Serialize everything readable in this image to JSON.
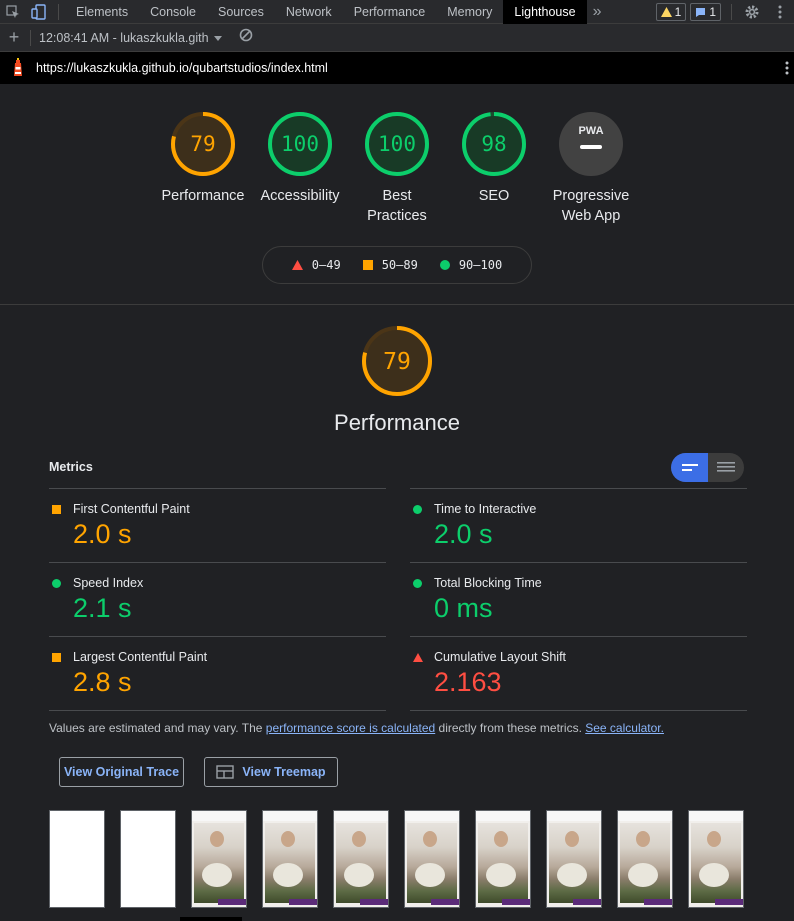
{
  "devtools": {
    "tabs": [
      "Elements",
      "Console",
      "Sources",
      "Network",
      "Performance",
      "Memory",
      "Lighthouse"
    ],
    "active_tab": "Lighthouse",
    "more_tabs": "»",
    "warnings_count": "1",
    "messages_count": "1"
  },
  "toolbar": {
    "report_selector": "12:08:41 AM - lukaszkukla.gith"
  },
  "urlbar": {
    "url": "https://lukaszkukla.github.io/qubartstudios/index.html"
  },
  "gauges": [
    {
      "score": 79,
      "label": "Performance",
      "rating": "average"
    },
    {
      "score": 100,
      "label": "Accessibility",
      "rating": "pass"
    },
    {
      "score": 100,
      "label": "Best Practices",
      "rating": "pass"
    },
    {
      "score": 98,
      "label": "SEO",
      "rating": "pass"
    },
    {
      "score": null,
      "label": "Progressive Web App",
      "rating": "na",
      "badge": "PWA"
    }
  ],
  "legend": {
    "fail": "0–49",
    "average": "50–89",
    "pass": "90–100"
  },
  "performance": {
    "score": "79",
    "title": "Performance"
  },
  "metrics": {
    "heading": "Metrics",
    "items": [
      {
        "title": "First Contentful Paint",
        "value": "2.0 s",
        "rating": "average"
      },
      {
        "title": "Time to Interactive",
        "value": "2.0 s",
        "rating": "pass"
      },
      {
        "title": "Speed Index",
        "value": "2.1 s",
        "rating": "pass"
      },
      {
        "title": "Total Blocking Time",
        "value": "0 ms",
        "rating": "pass"
      },
      {
        "title": "Largest Contentful Paint",
        "value": "2.8 s",
        "rating": "average"
      },
      {
        "title": "Cumulative Layout Shift",
        "value": "2.163",
        "rating": "fail"
      }
    ],
    "note_prefix": "Values are estimated and may vary. The ",
    "note_link1": "performance score is calculated",
    "note_middle": " directly from these metrics. ",
    "note_link2": "See calculator."
  },
  "buttons": {
    "trace": "View Original Trace",
    "treemap": "View Treemap"
  },
  "colors": {
    "pass": "#0cce6b",
    "average": "#ffa400",
    "fail": "#ff4e42",
    "accent": "#3c6ee6"
  },
  "filmstrip": {
    "blank_frames": 2,
    "content_frames": 8
  }
}
